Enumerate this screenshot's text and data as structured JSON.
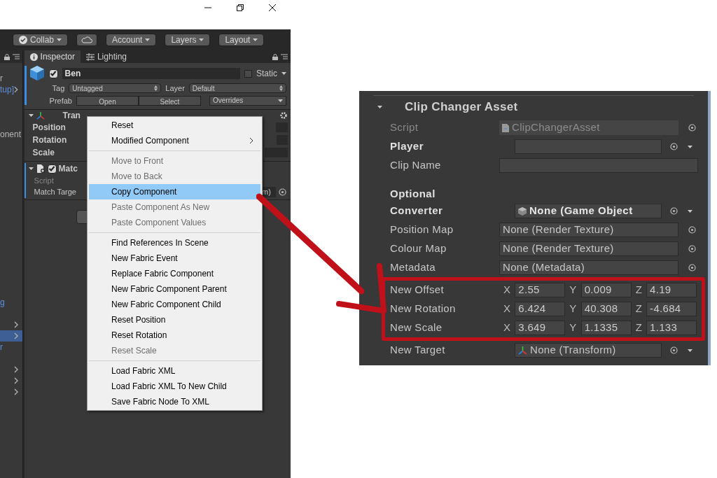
{
  "toolbar": {
    "collab": "Collab",
    "account": "Account",
    "layers": "Layers",
    "layout": "Layout"
  },
  "hierarchy": [
    {
      "kind": "text",
      "text": "r"
    },
    {
      "kind": "link",
      "text": "tup]",
      "arrow": true,
      "selected": false
    },
    {
      "kind": "blank"
    },
    {
      "kind": "blank"
    },
    {
      "kind": "blank"
    },
    {
      "kind": "text",
      "text": "onent"
    },
    {
      "kind": "blank"
    },
    {
      "kind": "blank"
    },
    {
      "kind": "blank"
    },
    {
      "kind": "blank"
    },
    {
      "kind": "blank"
    },
    {
      "kind": "blank"
    },
    {
      "kind": "blank"
    },
    {
      "kind": "blank"
    },
    {
      "kind": "blank"
    },
    {
      "kind": "blank"
    },
    {
      "kind": "blank"
    },
    {
      "kind": "blank"
    },
    {
      "kind": "blank"
    },
    {
      "kind": "blank"
    },
    {
      "kind": "link",
      "text": "g",
      "arrow": false,
      "selected": false
    },
    {
      "kind": "blank"
    },
    {
      "kind": "link",
      "arrow": true,
      "selected": false
    },
    {
      "kind": "link",
      "arrow": true,
      "selected": true
    },
    {
      "kind": "link",
      "text": "r",
      "arrow": false,
      "selected": false
    },
    {
      "kind": "blank"
    },
    {
      "kind": "link",
      "arrow": true,
      "selected": false
    },
    {
      "kind": "link",
      "arrow": true,
      "selected": false
    },
    {
      "kind": "link",
      "arrow": true,
      "selected": false
    }
  ],
  "tabs": [
    {
      "label": "Inspector",
      "selected": true
    },
    {
      "label": "Lighting",
      "selected": false
    }
  ],
  "object": {
    "active": true,
    "name": "Ben",
    "static_label": "Static",
    "static": false,
    "tag_label": "Tag",
    "tag": "Untagged",
    "layer_label": "Layer",
    "layer": "Default",
    "prefab_label": "Prefab",
    "prefab_buttons": [
      "Open",
      "Select"
    ],
    "overrides": "Overrides"
  },
  "transform": {
    "title": "Tran",
    "fields": [
      "Position",
      "Rotation",
      "Scale"
    ]
  },
  "component": {
    "title": "Matc",
    "enabled": true,
    "script_label": "Script",
    "field_label": "Match Targe",
    "field_value": "m)"
  },
  "context_menu": [
    {
      "label": "Reset",
      "disabled": false,
      "selected": false,
      "submenu": false
    },
    {
      "label": "Modified Component",
      "disabled": false,
      "selected": false,
      "submenu": true,
      "separator_after": true
    },
    {
      "label": "Move to Front",
      "disabled": true,
      "selected": false,
      "submenu": false
    },
    {
      "label": "Move to Back",
      "disabled": true,
      "selected": false,
      "submenu": false
    },
    {
      "label": "Copy Component",
      "disabled": false,
      "selected": true,
      "submenu": false
    },
    {
      "label": "Paste Component As New",
      "disabled": true,
      "selected": false,
      "submenu": false
    },
    {
      "label": "Paste Component Values",
      "disabled": true,
      "selected": false,
      "submenu": false,
      "separator_after": true
    },
    {
      "label": "Find References In Scene",
      "disabled": false,
      "selected": false,
      "submenu": false
    },
    {
      "label": "New Fabric Event",
      "disabled": false,
      "selected": false,
      "submenu": false
    },
    {
      "label": "Replace Fabric Component",
      "disabled": false,
      "selected": false,
      "submenu": false
    },
    {
      "label": "New Fabric Component Parent",
      "disabled": false,
      "selected": false,
      "submenu": false
    },
    {
      "label": "New Fabric Component Child",
      "disabled": false,
      "selected": false,
      "submenu": false
    },
    {
      "label": "Reset Position",
      "disabled": false,
      "selected": false,
      "submenu": false
    },
    {
      "label": "Reset Rotation",
      "disabled": false,
      "selected": false,
      "submenu": false
    },
    {
      "label": "Reset Scale",
      "disabled": true,
      "selected": false,
      "submenu": false,
      "separator_after": true
    },
    {
      "label": "Load Fabric XML",
      "disabled": false,
      "selected": false,
      "submenu": false
    },
    {
      "label": "Load Fabric XML To New Child",
      "disabled": false,
      "selected": false,
      "submenu": false
    },
    {
      "label": "Save Fabric Node To XML",
      "disabled": false,
      "selected": false,
      "submenu": false
    }
  ],
  "asset_panel": {
    "title": "Clip Changer Asset",
    "rows": [
      {
        "kind": "script",
        "label": "Script",
        "value": "ClipChangerAsset"
      },
      {
        "kind": "object",
        "label": "Player",
        "bold": true,
        "value": ""
      },
      {
        "kind": "text",
        "label": "Clip Name",
        "value": ""
      },
      {
        "kind": "heading",
        "label": "Optional"
      },
      {
        "kind": "gameobject",
        "label": "Converter",
        "bold": true,
        "value": "None (Game Object"
      },
      {
        "kind": "asset",
        "label": "Position Map",
        "value": "None (Render Texture)"
      },
      {
        "kind": "asset",
        "label": "Colour Map",
        "value": "None (Render Texture)"
      },
      {
        "kind": "asset",
        "label": "Metadata",
        "value": "None (Metadata)"
      },
      {
        "kind": "highlight",
        "rows": [
          {
            "kind": "vector",
            "label": "New Offset",
            "axes": [
              {
                "axis": "X",
                "value": "2.55"
              },
              {
                "axis": "Y",
                "value": "0.009"
              },
              {
                "axis": "Z",
                "value": "4.19"
              }
            ]
          },
          {
            "kind": "vector",
            "label": "New Rotation",
            "axes": [
              {
                "axis": "X",
                "value": "6.424"
              },
              {
                "axis": "Y",
                "value": "40.308"
              },
              {
                "axis": "Z",
                "value": "-4.684"
              }
            ]
          },
          {
            "kind": "vector",
            "label": "New Scale",
            "axes": [
              {
                "axis": "X",
                "value": "3.649"
              },
              {
                "axis": "Y",
                "value": "1.1335"
              },
              {
                "axis": "Z",
                "value": "1.133"
              }
            ]
          }
        ]
      },
      {
        "kind": "transform",
        "label": "New Target",
        "bold": false,
        "value": "None (Transform)"
      }
    ]
  }
}
